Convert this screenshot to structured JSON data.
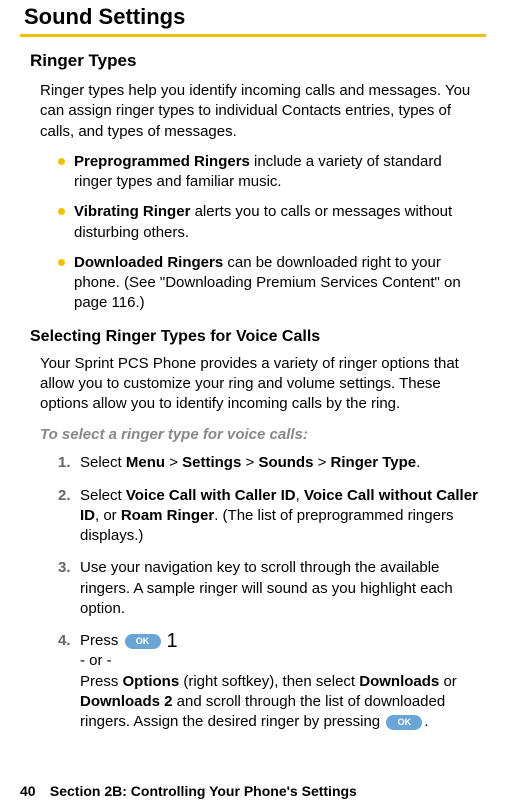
{
  "title": "Sound Settings",
  "section_heading": "Ringer Types",
  "intro": "Ringer types help you identify incoming calls and messages. You can assign ringer types to individual Contacts entries, types of calls, and types of messages.",
  "bullets": [
    {
      "term": "Preprogrammed Ringers",
      "rest": " include a variety of standard ringer types and familiar music."
    },
    {
      "term": "Vibrating Ringer",
      "rest": " alerts you to calls or messages without disturbing others."
    },
    {
      "term": "Downloaded Ringers",
      "rest": " can be downloaded right to your phone. (See \"Downloading Premium Services Content\" on page 116.)"
    }
  ],
  "sub_heading": "Selecting Ringer Types for Voice Calls",
  "sub_body": "Your Sprint PCS Phone provides a variety of ringer options that allow you to customize your ring and volume settings. These options allow you to identify incoming calls by the ring.",
  "instruction": "To select a ringer type for voice calls:",
  "steps": {
    "s1": {
      "lead": "Select ",
      "menu": "Menu",
      "gt1": " > ",
      "settings": "Settings",
      "gt2": " > ",
      "sounds": "Sounds",
      "gt3": " > ",
      "ringer": "Ringer Type",
      "tail": "."
    },
    "s2": {
      "lead": "Select ",
      "a": "Voice Call with Caller ID",
      "c1": ", ",
      "b": "Voice Call without Caller ID",
      "c2": ", or ",
      "c": "Roam Ringer",
      "tail": ". (The list of preprogrammed ringers displays.)"
    },
    "s3": "Use your navigation key to scroll through the available ringers. A sample ringer will sound as you highlight each option.",
    "s4": {
      "press": "Press ",
      "ok": "OK",
      "note": "1",
      "or": "- or -",
      "line2a": "Press ",
      "opt": "Options",
      "line2b": " (right softkey), then select ",
      "d1": "Downloads",
      "line2c": " or ",
      "d2": "Downloads 2",
      "line2d": " and scroll through the list of downloaded ringers. Assign the desired ringer by pressing ",
      "tail": "."
    }
  },
  "footer": {
    "page_number": "40",
    "section_label": "Section 2B: Controlling Your Phone's Settings"
  }
}
